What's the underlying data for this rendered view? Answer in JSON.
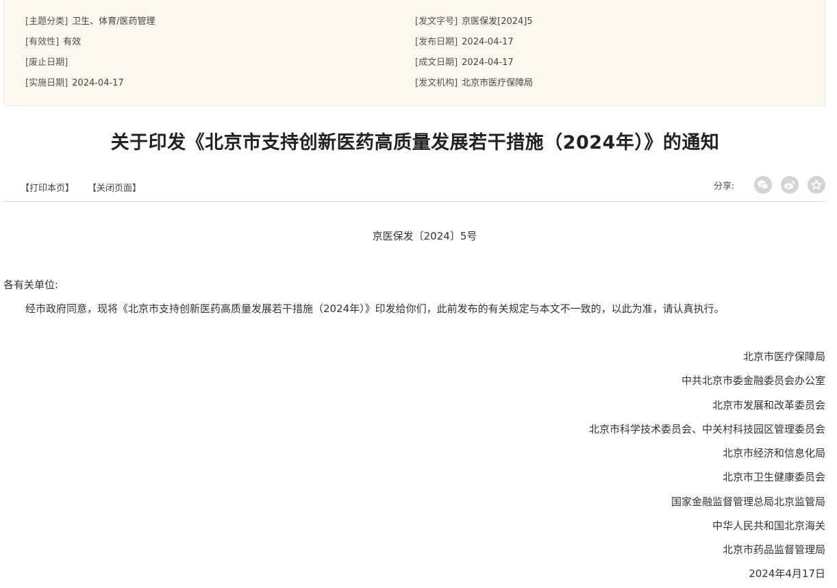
{
  "meta": {
    "left": [
      {
        "key": "[主题分类]",
        "value": "卫生、体育/医药管理"
      },
      {
        "key": "[有效性]",
        "value": "有效"
      },
      {
        "key": "[废止日期]",
        "value": ""
      },
      {
        "key": "[实施日期]",
        "value": "2024-04-17"
      }
    ],
    "right": [
      {
        "key": "[发文字号]",
        "value": "京医保发[2024]5"
      },
      {
        "key": "[发布日期]",
        "value": "2024-04-17"
      },
      {
        "key": "[成文日期]",
        "value": "2024-04-17"
      },
      {
        "key": "[发文机构]",
        "value": "北京市医疗保障局"
      }
    ]
  },
  "title": "关于印发《北京市支持创新医药高质量发展若干措施（2024年）》的通知",
  "toolbar": {
    "print_label": "【打印本页】",
    "close_label": "【关闭页面】",
    "share_label": "分享:"
  },
  "share_icons": [
    "wechat-icon",
    "weibo-icon",
    "favorite-icon"
  ],
  "document": {
    "number": "京医保发〔2024〕5号",
    "salutation": "各有关单位:",
    "body": "经市政府同意，现将《北京市支持创新医药高质量发展若干措施（2024年）》印发给你们，此前发布的有关规定与本文不一致的，以此为准，请认真执行。",
    "signatories": [
      "北京市医疗保障局",
      "中共北京市委金融委员会办公室",
      "北京市发展和改革委员会",
      "北京市科学技术委员会、中关村科技园区管理委员会",
      "北京市经济和信息化局",
      "北京市卫生健康委员会",
      "国家金融监督管理总局北京监管局",
      "中华人民共和国北京海关",
      "北京市药品监督管理局",
      "2024年4月17日"
    ]
  },
  "colors": {
    "meta_background": "#fcf8f0",
    "share_icon_bg": "#d4d4d4"
  }
}
